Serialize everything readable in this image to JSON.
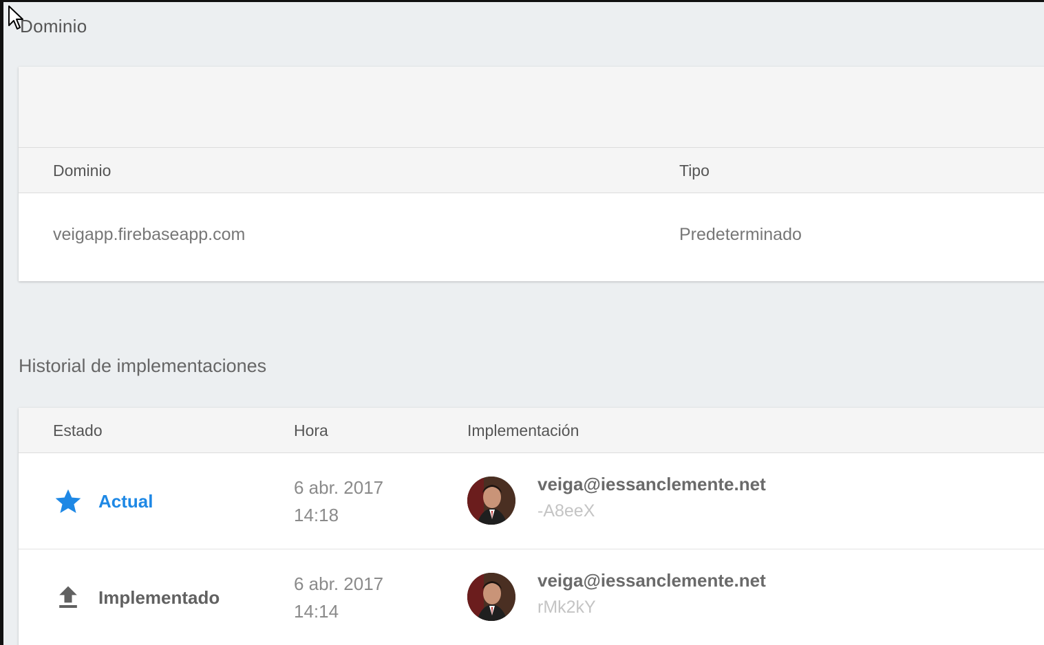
{
  "domain_section": {
    "title": "Dominio",
    "table": {
      "columns": [
        "Dominio",
        "Tipo"
      ],
      "rows": [
        {
          "domain": "veigapp.firebaseapp.com",
          "type": "Predeterminado"
        }
      ]
    }
  },
  "history_section": {
    "title": "Historial de implementaciones",
    "columns": [
      "Estado",
      "Hora",
      "Implementación"
    ],
    "rows": [
      {
        "status": "Actual",
        "status_icon": "star-icon",
        "date": "6 abr. 2017",
        "time": "14:18",
        "user": "veiga@iessanclemente.net",
        "version_id": "-A8eeX"
      },
      {
        "status": "Implementado",
        "status_icon": "upload-icon",
        "date": "6 abr. 2017",
        "time": "14:14",
        "user": "veiga@iessanclemente.net",
        "version_id": "rMk2kY"
      }
    ]
  },
  "colors": {
    "accent": "#1e88e5",
    "background": "#eceff1",
    "header_bg": "#f5f5f5"
  }
}
